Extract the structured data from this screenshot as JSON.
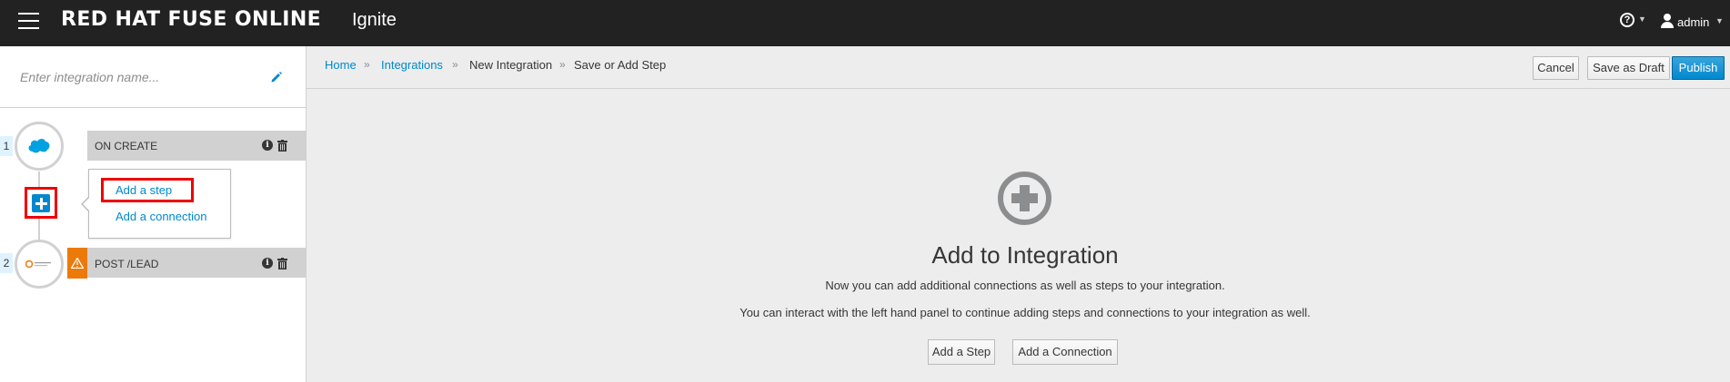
{
  "navbar": {
    "brand": "RED HAT FUSE ONLINE",
    "product": "Ignite",
    "help_label": "?",
    "user": "admin"
  },
  "left_panel": {
    "name_placeholder": "Enter integration name...",
    "steps": [
      {
        "number": "1",
        "title": "ON CREATE",
        "icon": "salesforce-icon"
      },
      {
        "number": "2",
        "title": "POST /LEAD",
        "icon": "api-connector-icon",
        "warning": true
      }
    ],
    "popover": {
      "add_step": "Add a step",
      "add_connection": "Add a connection"
    }
  },
  "breadcrumb": {
    "home": "Home",
    "integrations": "Integrations",
    "new_integration": "New Integration",
    "current": "Save or Add Step",
    "separator": "»"
  },
  "actions": {
    "cancel": "Cancel",
    "save_draft": "Save as Draft",
    "publish": "Publish"
  },
  "empty_state": {
    "title": "Add to Integration",
    "line1": "Now you can add additional connections as well as steps to your integration.",
    "line2": "You can interact with the left hand panel to continue adding steps and connections to your integration as well.",
    "add_step_button": "Add a Step",
    "add_connection_button": "Add a Connection"
  },
  "colors": {
    "navbar_bg": "#222222",
    "link": "#0088ce",
    "primary": "#0088ce",
    "warning": "#ec7a08",
    "highlight": "#ee0000"
  }
}
